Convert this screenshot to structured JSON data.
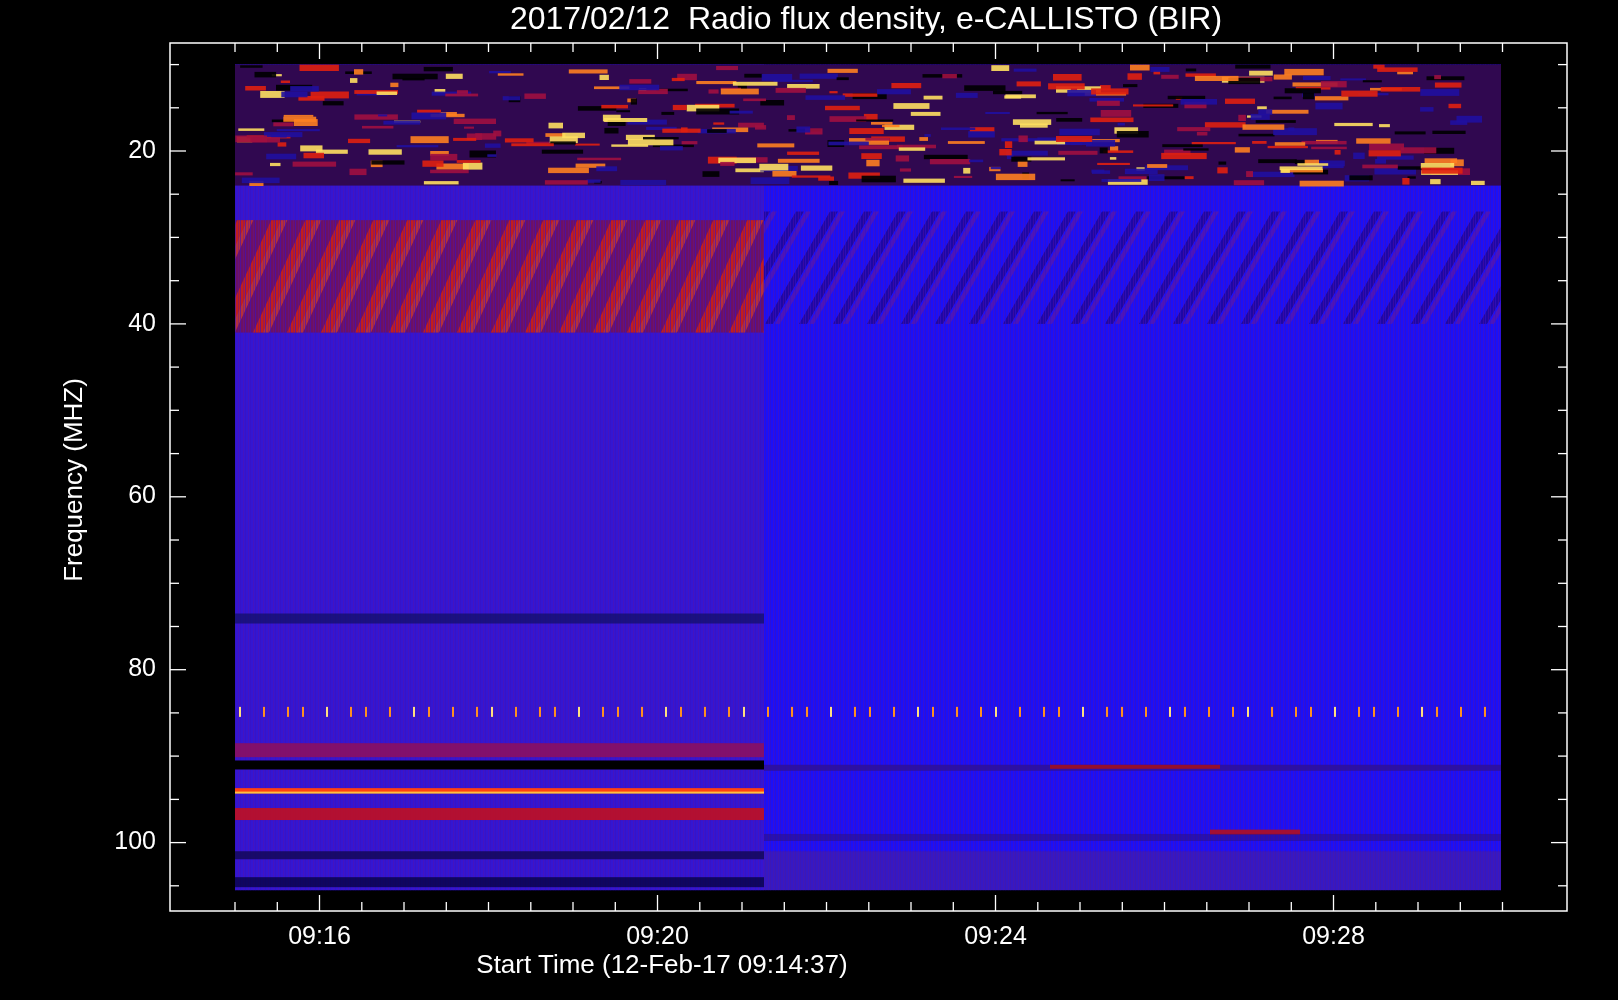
{
  "title": "2017/02/12  Radio flux density, e-CALLISTO (BIR)",
  "y_axis": {
    "label": "Frequency (MHZ)",
    "tick_labels": [
      "20",
      "40",
      "60",
      "80",
      "100"
    ]
  },
  "x_axis": {
    "label": "Start Time (12-Feb-17 09:14:37)",
    "tick_labels": [
      "09:16",
      "09:20",
      "09:24",
      "09:28"
    ]
  }
}
